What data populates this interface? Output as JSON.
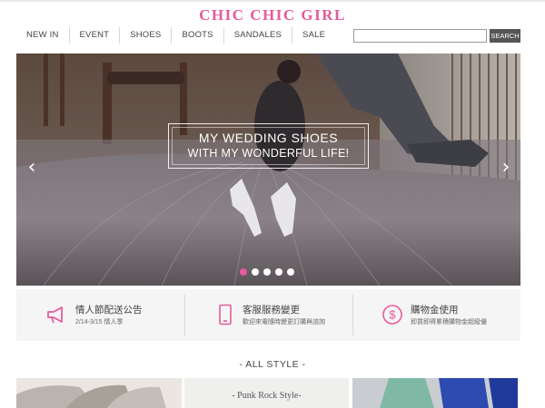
{
  "brand": {
    "logo": "CHIC CHIC GIRL",
    "accent": "#e85a9b"
  },
  "nav": {
    "items": [
      "NEW IN",
      "EVENT",
      "SHOES",
      "BOOTS",
      "SANDALES",
      "SALE"
    ]
  },
  "search": {
    "placeholder": "",
    "button_label": "SEARCH"
  },
  "hero": {
    "line1": "MY WEDDING SHOES",
    "line2": "WITH MY WONDERFUL LIFE!",
    "prev_icon": "chevron-left-icon",
    "next_icon": "chevron-right-icon",
    "slide_count": 5,
    "active_slide": 1
  },
  "info": [
    {
      "icon": "megaphone-icon",
      "title": "情人節配送公告",
      "subtitle": "2/14-3/15 情人季"
    },
    {
      "icon": "phone-icon",
      "title": "客服服務變更",
      "subtitle": "歡迎來電隨時變更訂購與諮詢"
    },
    {
      "icon": "dollar-coin-icon",
      "title": "購物金使用",
      "subtitle": "即買即得累積購物金超級優"
    }
  ],
  "section": {
    "title": "- ALL STYLE -"
  },
  "thumbnails": {
    "label_2": "- Punk Rock Style-"
  }
}
